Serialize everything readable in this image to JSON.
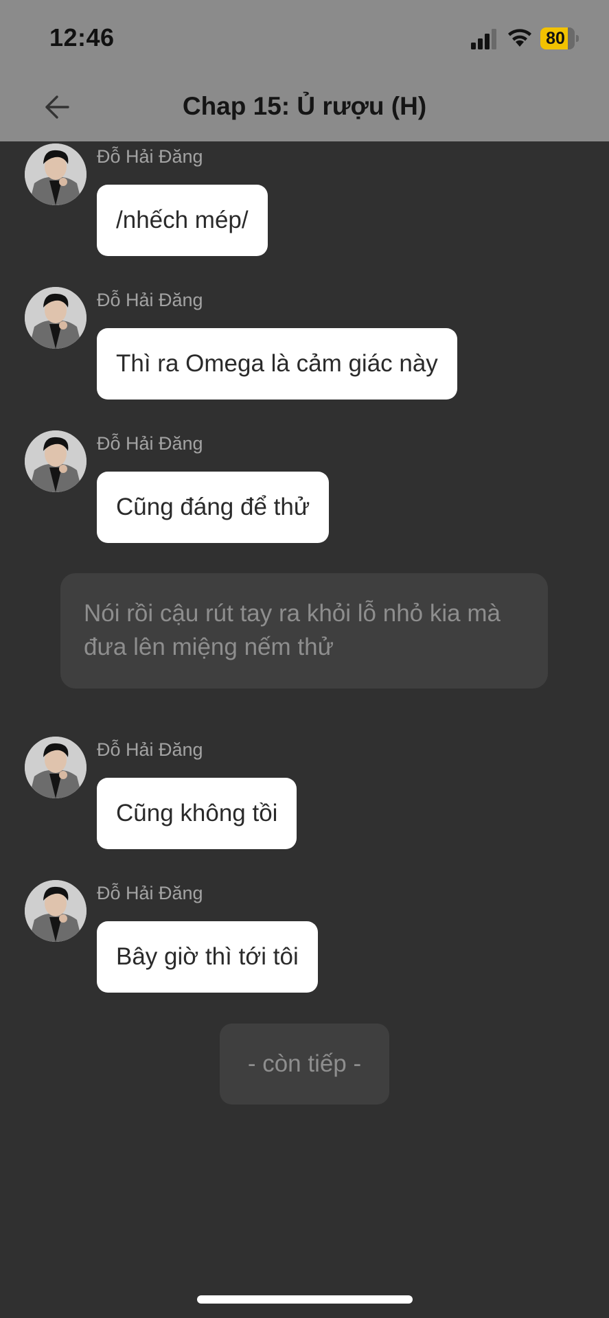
{
  "status_bar": {
    "time": "12:46",
    "battery_level": "80",
    "battery_fraction": 0.8,
    "battery_color": "#f2c200",
    "icons": [
      "cellular-signal-icon",
      "wifi-icon",
      "battery-icon"
    ]
  },
  "header": {
    "title": "Chap 15: Ủ rượu (H)",
    "back_icon": "arrow-left-icon",
    "background": "#8b8b8b"
  },
  "messages": [
    {
      "sender": "Đỗ Hải Đăng",
      "text": "/nhếch mép/"
    },
    {
      "sender": "Đỗ Hải Đăng",
      "text": "Thì ra Omega là cảm giác này"
    },
    {
      "sender": "Đỗ Hải Đăng",
      "text": "Cũng đáng để thử"
    },
    {
      "sender": "Đỗ Hải Đăng",
      "text": "Cũng không tồi"
    },
    {
      "sender": "Đỗ Hải Đăng",
      "text": "Bây giờ thì tới tôi"
    }
  ],
  "narration": {
    "text": "Nói rồi cậu rút tay ra khỏi lỗ nhỏ kia mà đưa lên miệng nếm thử"
  },
  "footer": {
    "continue_label": "- còn tiếp -"
  },
  "colors": {
    "background": "#303030",
    "bubble": "#ffffff",
    "narration_box": "#3f3f3f"
  }
}
